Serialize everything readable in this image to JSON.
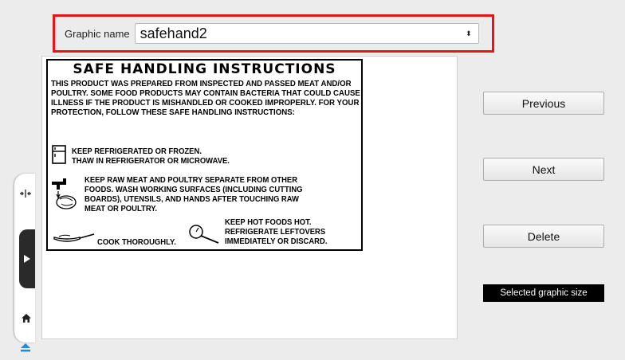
{
  "selector": {
    "label": "Graphic name",
    "value": "safehand2",
    "arrows": "⬍"
  },
  "label_card": {
    "title": "SAFE HANDLING INSTRUCTIONS",
    "intro": "THIS PRODUCT WAS PREPARED FROM INSPECTED AND PASSED MEAT AND/OR POULTRY. SOME FOOD PRODUCTS MAY CONTAIN BACTERIA THAT COULD CAUSE ILLNESS IF THE PRODUCT IS MISHANDLED OR COOKED IMPROPERLY. FOR YOUR PROTECTION, FOLLOW THESE SAFE HANDLING INSTRUCTIONS:",
    "refrigerate_line1": "KEEP REFRIGERATED OR FROZEN.",
    "refrigerate_line2": "THAW IN REFRIGERATOR OR MICROWAVE.",
    "separate_line1": "KEEP RAW MEAT AND POULTRY SEPARATE FROM OTHER",
    "separate_line2": "FOODS. WASH WORKING SURFACES (INCLUDING CUTTING",
    "separate_line3": "BOARDS), UTENSILS, AND HANDS AFTER TOUCHING RAW",
    "separate_line4": "MEAT OR POULTRY.",
    "cook": "COOK THOROUGHLY.",
    "hot_line1": "KEEP HOT FOODS HOT.",
    "hot_line2": "REFRIGERATE LEFTOVERS",
    "hot_line3": "IMMEDIATELY OR DISCARD."
  },
  "buttons": {
    "previous": "Previous",
    "next": "Next",
    "delete": "Delete"
  },
  "size_badge": "Selected graphic size",
  "icons": {
    "rail_compress": "compress-icon",
    "rail_play": "play-icon",
    "rail_home": "home-icon",
    "rail_eject": "eject-icon"
  },
  "colors": {
    "highlight_border": "#e8141b",
    "eject_accent": "#1e8fd6"
  }
}
